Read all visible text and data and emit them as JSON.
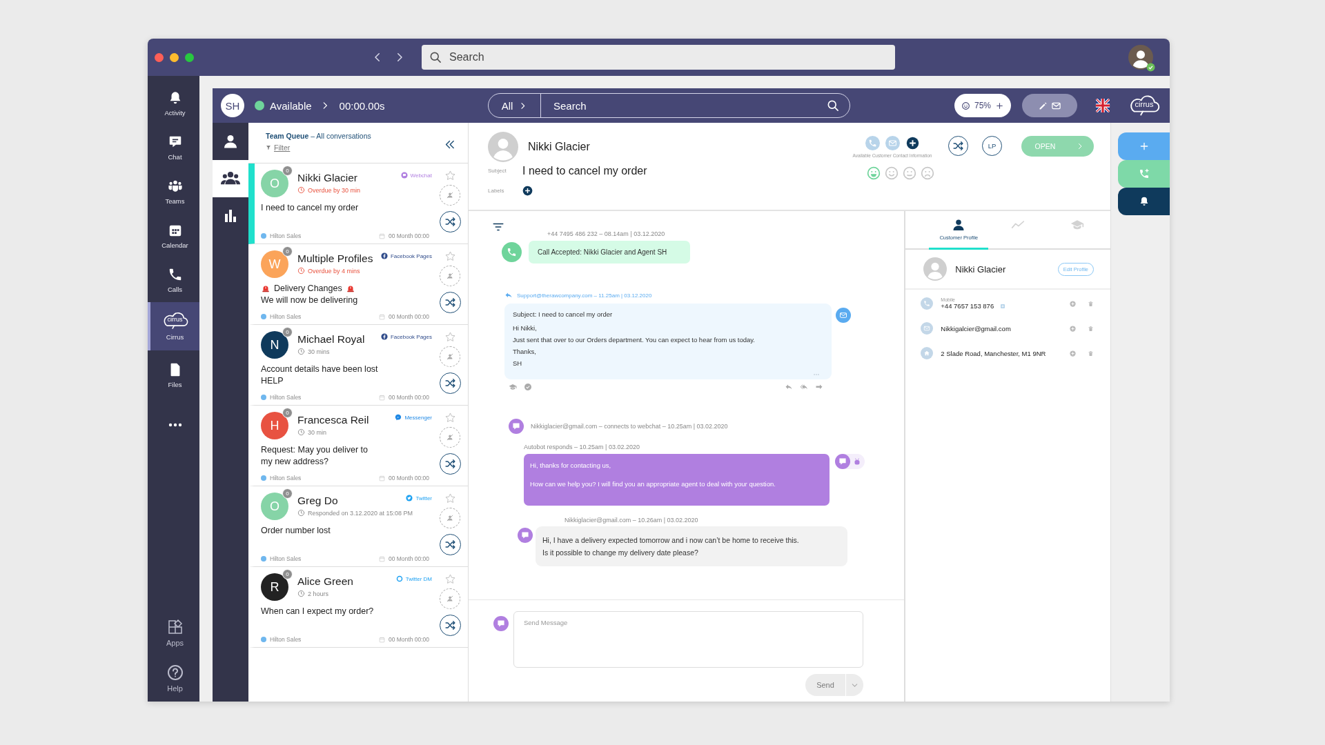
{
  "titlebar": {
    "search_placeholder": "Search"
  },
  "rail": [
    {
      "kind": "activity",
      "label": "Activity",
      "selected": false
    },
    {
      "kind": "chat",
      "label": "Chat",
      "selected": false
    },
    {
      "kind": "teams",
      "label": "Teams",
      "selected": false
    },
    {
      "kind": "calendar",
      "label": "Calendar",
      "selected": false
    },
    {
      "kind": "calls",
      "label": "Calls",
      "selected": false
    },
    {
      "kind": "cirrus",
      "label": "Cirrus",
      "logo_text": "cirrus",
      "selected": true
    },
    {
      "kind": "files",
      "label": "Files",
      "selected": false
    },
    {
      "kind": "more",
      "selected": false
    }
  ],
  "rail_bottom": [
    {
      "kind": "apps",
      "label": "Apps"
    },
    {
      "kind": "help",
      "label": "Help"
    }
  ],
  "app_bar": {
    "agent_initials": "SH",
    "status": "Available",
    "timer": "00:00.00s",
    "scope": "All",
    "search_placeholder": "Search",
    "satisfaction": "75%",
    "logo_text": "cirrus"
  },
  "side_tabs": [
    {
      "kind": "agent",
      "selected": false
    },
    {
      "kind": "team",
      "selected": true
    },
    {
      "kind": "stats",
      "selected": false
    }
  ],
  "queue": {
    "title": "**Team Queue** – All conversations",
    "filter": "Filter",
    "conversations": [
      {
        "name": "Nikki Glacier",
        "initial": "O",
        "color": "#86d4a7",
        "count": "0",
        "channel": {
          "kind": "webchat",
          "label": "Webchat",
          "color": "#b07fe0"
        },
        "time": "Overdue by 30 min",
        "overdue": true,
        "preview": [
          {
            "text": "I need to cancel my order",
            "alert": false
          }
        ],
        "team": "Hilton Sales",
        "date": "00 Month 00:00",
        "selected": true
      },
      {
        "name": "Multiple Profiles",
        "initial": "W",
        "color": "#fba45a",
        "count": "0",
        "channel": {
          "kind": "facebook",
          "label": "Facebook Pages",
          "color": "#2f4b8a"
        },
        "time": "Overdue by 4 mins",
        "overdue": true,
        "preview": [
          {
            "text": "Delivery Changes",
            "alert": true
          },
          {
            "text": "We will now be delivering",
            "alert": false
          }
        ],
        "team": "Hilton Sales",
        "date": "00 Month 00:00",
        "selected": false
      },
      {
        "name": "Michael Royal",
        "initial": "N",
        "color": "#0f3a5c",
        "count": "0",
        "channel": {
          "kind": "facebook",
          "label": "Facebook Pages",
          "color": "#2f4b8a"
        },
        "time": "30 mins",
        "overdue": false,
        "preview": [
          {
            "text": "Account details have been lost",
            "alert": false
          },
          {
            "text": "HELP",
            "alert": false
          }
        ],
        "team": "Hilton Sales",
        "date": "00 Month 00:00",
        "selected": false
      },
      {
        "name": "Francesca Reil",
        "initial": "H",
        "color": "#e85241",
        "count": "0",
        "channel": {
          "kind": "messenger",
          "label": "Messenger",
          "color": "#1e88e5"
        },
        "time": "30 min",
        "overdue": false,
        "preview": [
          {
            "text": "Request: May you deliver to",
            "alert": false
          },
          {
            "text": "my new address?",
            "alert": false
          }
        ],
        "team": "Hilton Sales",
        "date": "00 Month 00:00",
        "selected": false
      },
      {
        "name": "Greg Do",
        "initial": "O",
        "color": "#86d4a7",
        "count": "0",
        "channel": {
          "kind": "twitter",
          "label": "Twitter",
          "color": "#1da1f2"
        },
        "time": "Responded on 3.12.2020 at 15:08 PM",
        "overdue": false,
        "preview": [
          {
            "text": "Order number lost",
            "alert": false
          }
        ],
        "team": "Hilton Sales",
        "date": "00 Month 00:00",
        "selected": false
      },
      {
        "name": "Alice Green",
        "initial": "R",
        "color": "#222222",
        "count": "0",
        "channel": {
          "kind": "twitterdm",
          "label": "Twitter DM",
          "color": "#1da1f2"
        },
        "time": "2 hours",
        "overdue": false,
        "preview": [
          {
            "text": "When can I expect my order?",
            "alert": false
          }
        ],
        "team": "Hilton Sales",
        "date": "00 Month 00:00",
        "selected": false
      }
    ]
  },
  "conversation": {
    "name": "Nikki Glacier",
    "contact_buttons": [
      {
        "kind": "phone"
      },
      {
        "kind": "email"
      },
      {
        "kind": "add"
      }
    ],
    "contact_caption": "Available Customer Contact Information",
    "assign_label": "LP",
    "status_button": "OPEN",
    "subject_label": "Subject",
    "subject": "I need to cancel my order",
    "labels_label": "Labels",
    "sentiments": [
      {
        "kind": "happy",
        "selected": true
      },
      {
        "kind": "smile",
        "selected": false
      },
      {
        "kind": "neutral",
        "selected": false
      },
      {
        "kind": "sad",
        "selected": false
      }
    ]
  },
  "messages": [
    {
      "kind": "call",
      "meta": "+44 7495 486 232 – 08.14am | 03.12.2020",
      "lines": [
        "Call Accepted: Nikki Glacier and Agent SH"
      ]
    },
    {
      "kind": "email",
      "meta": "Support@therawcompany.com – 11.25am | 03.12.2020",
      "lines": [
        "Subject: I need to cancel my order",
        "Hi Nikki,",
        "Just sent that over to our Orders department. You can expect to hear from us today.",
        "Thanks,",
        "SH"
      ]
    },
    {
      "kind": "event",
      "meta": "Nikkiglacier@gmail.com – connects to webchat – 10.25am | 03.02.2020"
    },
    {
      "kind": "bot",
      "meta": "Autobot responds – 10.25am | 03.02.2020",
      "lines": [
        "Hi, thanks for contacting us,",
        "How can we help you? I will find you an appropriate agent to deal with your question."
      ]
    },
    {
      "kind": "customer",
      "meta": "Nikkiglacier@gmail.com – 10.26am | 03.02.2020",
      "lines": [
        "Hi, I have a delivery expected tomorrow and i now can’t be home to receive this.",
        "Is it possible to change my delivery date please?"
      ]
    }
  ],
  "compose": {
    "placeholder": "Send Message",
    "send": "Send",
    "disabled": true
  },
  "profile": {
    "tabs": [
      {
        "kind": "profile",
        "label": "Customer Profile",
        "selected": true
      },
      {
        "kind": "activity",
        "selected": false
      },
      {
        "kind": "learning",
        "selected": false
      }
    ],
    "name": "Nikki Glacier",
    "edit": "Edit Profile",
    "contacts": [
      {
        "kind": "phone",
        "label": "Mobile",
        "value": "+44 7657 153 876"
      },
      {
        "kind": "email",
        "value": "Nikkigalcier@gmail.com"
      },
      {
        "kind": "home",
        "value": "2 Slade Road, Manchester, M1 9NR"
      }
    ]
  },
  "actions": [
    {
      "kind": "new"
    },
    {
      "kind": "call"
    },
    {
      "kind": "alert"
    }
  ]
}
